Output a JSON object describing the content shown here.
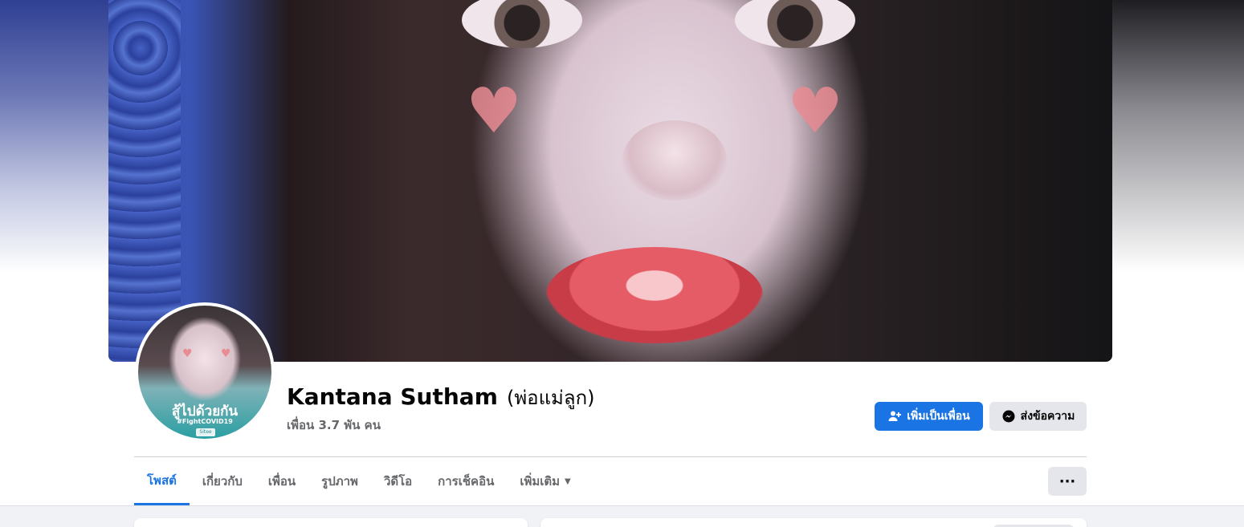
{
  "profile": {
    "name": "Kantana Sutham",
    "alternate_name": "(พ่อแม่ลูก)",
    "friends_count": "เพื่อน 3.7 พัน คน",
    "avatar_frame": {
      "title": "สู้ไปด้วยกัน",
      "hashtag": "#FightCOVID19",
      "badge": "Sitee"
    }
  },
  "actions": {
    "add_friend": "เพิ่มเป็นเพื่อน",
    "message": "ส่งข้อความ",
    "more": "···"
  },
  "tabs": [
    {
      "label": "โพสต์",
      "active": true
    },
    {
      "label": "เกี่ยวกับ",
      "active": false
    },
    {
      "label": "เพื่อน",
      "active": false
    },
    {
      "label": "รูปภาพ",
      "active": false
    },
    {
      "label": "วิดีโอ",
      "active": false
    },
    {
      "label": "การเช็คอิน",
      "active": false
    },
    {
      "label": "เพิ่มเติม",
      "active": false
    }
  ],
  "colors": {
    "accent": "#1b74e4",
    "secondary_button": "#e4e6eb",
    "muted_text": "#65676b"
  },
  "icons": {
    "add_friend": "person-plus-icon",
    "message": "messenger-icon",
    "more_dropdown": "caret-down-icon"
  }
}
